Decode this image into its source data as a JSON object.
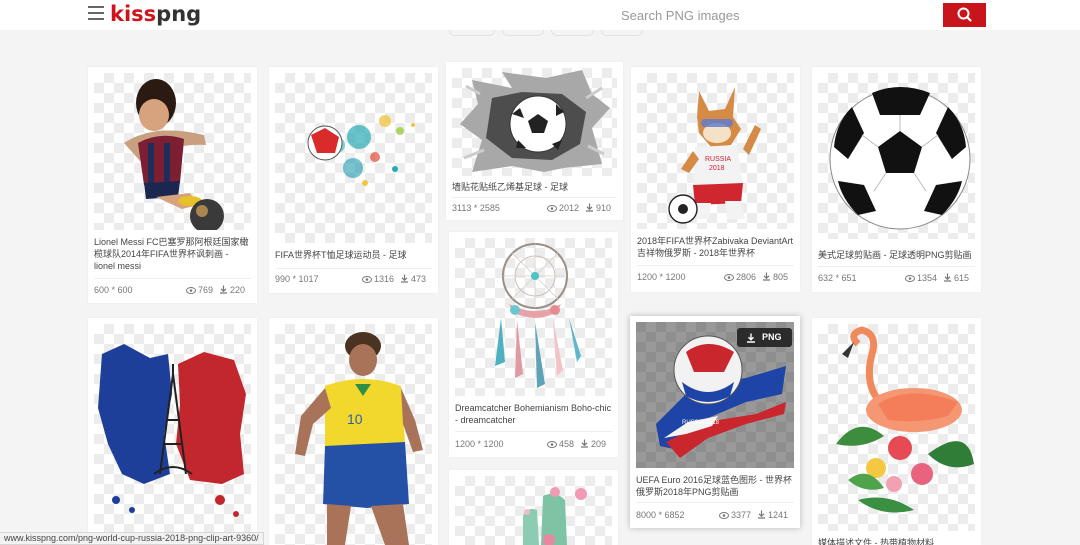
{
  "header": {
    "logo_kiss": "kiss",
    "logo_png": "png",
    "search_placeholder": "Search PNG images"
  },
  "cards": [
    {
      "id": "messi",
      "title": "Lionel Messi FC巴塞罗那阿根廷国家橄榄球队2014年FIFA世界杯讽刺画 - lionel messi",
      "size": "600 * 600",
      "views": "769",
      "downloads": "220"
    },
    {
      "id": "fifa-player",
      "title": "FIFA世界杯T恤足球运动员 - 足球",
      "size": "990 * 1017",
      "views": "1316",
      "downloads": "473"
    },
    {
      "id": "wall-ball",
      "title": "墙贴花贴纸乙烯基足球 - 足球",
      "size": "3113 * 2585",
      "views": "2012",
      "downloads": "910"
    },
    {
      "id": "zabivaka",
      "title": "2018年FIFA世界杯Zabivaka DeviantArt吉祥物俄罗斯 - 2018年世界杯",
      "size": "1200 * 1200",
      "views": "2806",
      "downloads": "805"
    },
    {
      "id": "soccer-ball",
      "title": "美式足球剪贴画 - 足球透明PNG剪贴画",
      "size": "632 * 651",
      "views": "1354",
      "downloads": "615"
    },
    {
      "id": "dreamcatcher",
      "title": "Dreamcatcher Bohemianism Boho-chic - dreamcatcher",
      "size": "1200 * 1200",
      "views": "458",
      "downloads": "209"
    },
    {
      "id": "uefa",
      "title": "UEFA Euro 2016足球蓝色图形 - 世界杯俄罗斯2018年PNG剪贴画",
      "size": "8000 * 6852",
      "views": "3377",
      "downloads": "1241"
    },
    {
      "id": "flamingo",
      "title": "媒体描述文件 - 热带植物材料"
    }
  ],
  "png_badge": "PNG",
  "status_url": "www.kisspng.com/png-world-cup-russia-2018-png-clip-art-9360/"
}
